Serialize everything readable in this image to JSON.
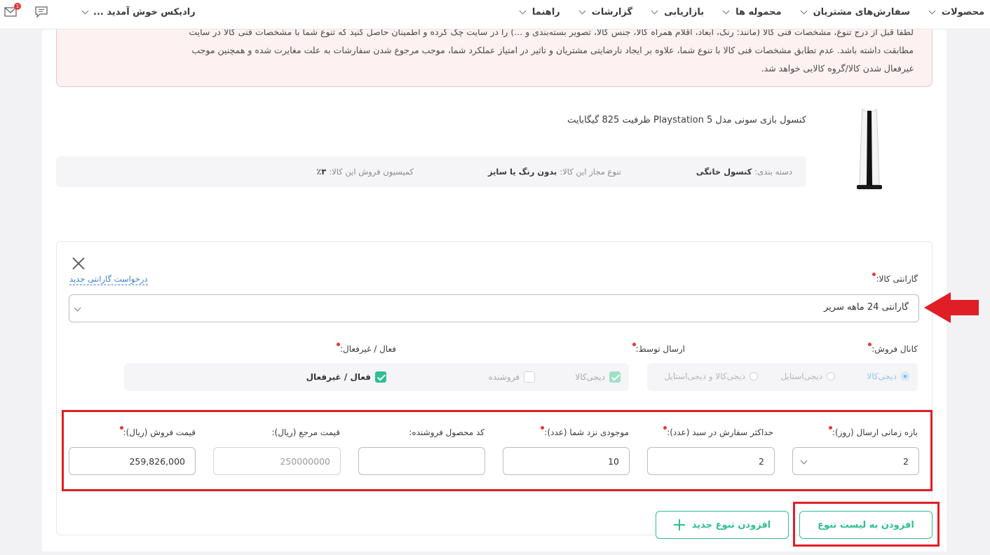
{
  "nav": {
    "items": [
      "محصولات",
      "سفارش‌های مشتریان",
      "محموله ها",
      "بازاریابی",
      "گزارشات",
      "راهنما"
    ],
    "welcome": "رادیکس خوش آمدید ...",
    "mail_badge": "1"
  },
  "alert": {
    "line1": "لطفا قبل از درج تنوع، مشخصات فنی کالا (مانند: رنگ، ابعاد، اقلام همراه کالا، جنس کالا، تصویر بسته‌بندی و ...) را در سایت چک کرده و اطمینان حاصل کنید که تنوع شما با مشخصات فنی کالا در سایت",
    "line2": "مطابقت داشته باشد. عدم تطابق مشخصات فنی کالا با تنوع شما، علاوه بر ایجاد نارضایتی مشتریان و تاثیر در امتیاز عملکرد شما، موجب مرجوع شدن سفارشات به علت مغایرت شده و همچنین موجب",
    "line3": "غیرفعال شدن کالا/گروه کالایی خواهد شد."
  },
  "product": {
    "title": "کنسول بازی سونی مدل Playstation 5 ظرفیت 825 گیگابایت",
    "category_label": "دسته بندی:",
    "category_value": "کنسول خانگی",
    "variant_label": "تنوع مجاز این کالا:",
    "variant_value": "بدون رنگ یا سایز",
    "commission_label": "کمیسیون فروش این کالا:",
    "commission_value": "٪۳"
  },
  "form": {
    "warranty_label": "گارانتی کالا:",
    "warranty_request_link": "درخواست گارانتی جدید",
    "warranty_value": "گارانتی 24 ماهه سرير",
    "sales_channel_label": "کانال فروش:",
    "sales_channel_options": [
      "دیجی‌کالا",
      "دیجی‌استایل",
      "دیجی‌کالا و دیجی‌استایل"
    ],
    "shipping_label": "ارسال توسط:",
    "shipping_options": [
      "دیجی‌کالا",
      "فروشنده"
    ],
    "active_label": "فعال / غیرفعال:",
    "active_option": "فعال / غیرفعال",
    "lead_time_label": "بازه زمانی ارسال (روز):",
    "lead_time_value": "2",
    "max_cart_label": "حداکثر سفارش در سبد (عدد):",
    "max_cart_value": "2",
    "stock_label": "موجودی نزد شما (عدد):",
    "stock_value": "10",
    "seller_code_label": "کد محصول فروشنده:",
    "seller_code_value": "",
    "ref_price_label": "قیمت مرجع (ریال):",
    "ref_price_value": "250000000",
    "sale_price_label": "قیمت فروش (ریال):",
    "sale_price_value": "259,826,000"
  },
  "buttons": {
    "add_to_list": "افزودن به لیست تنوع",
    "add_new_variant": "افزودن تنوع جدید"
  },
  "colors": {
    "accent": "#2fbf8f",
    "highlight": "#e01e26",
    "link": "#3d80d0"
  }
}
